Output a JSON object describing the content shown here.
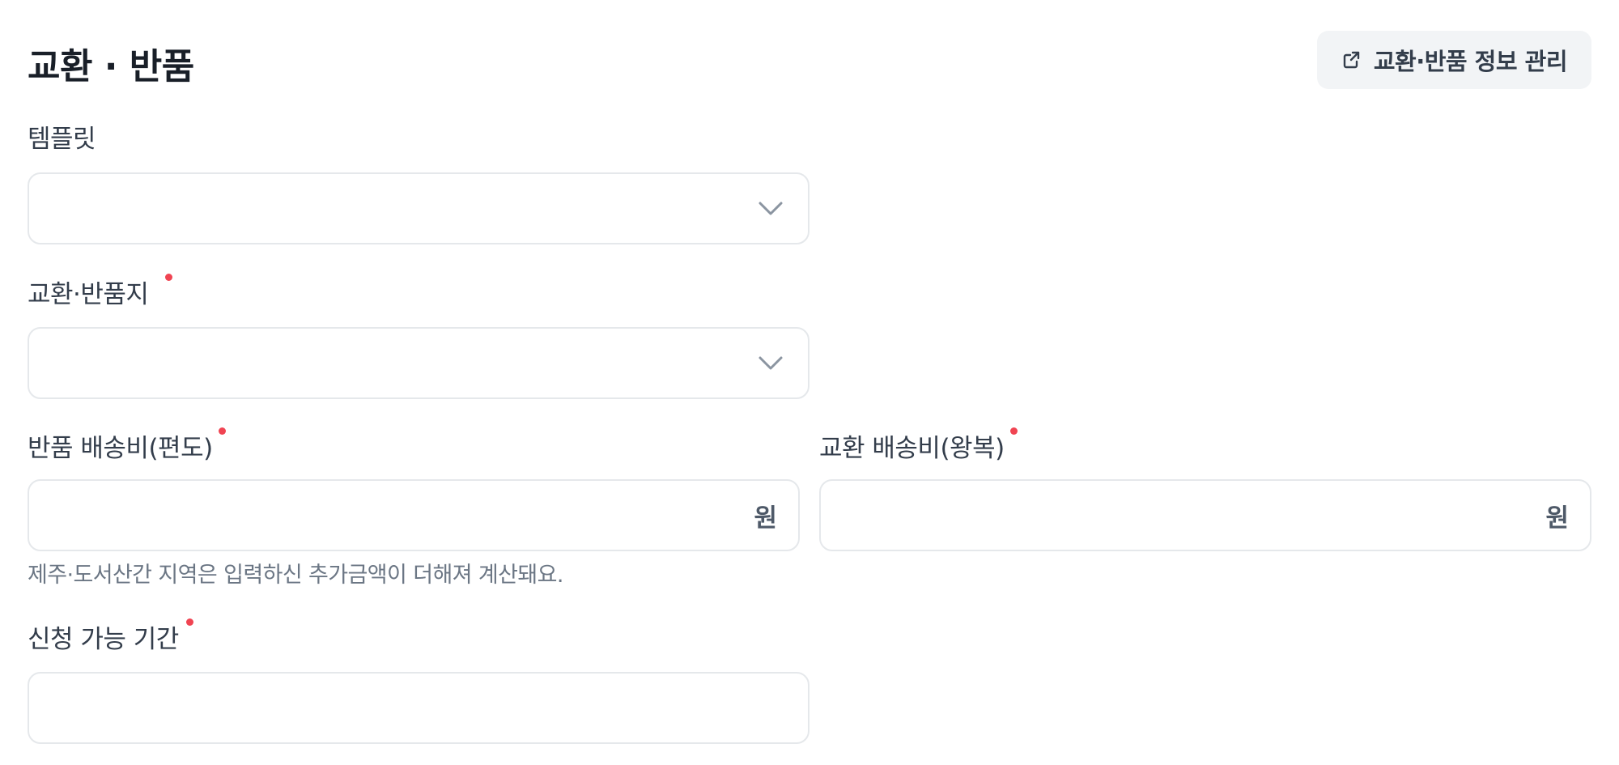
{
  "header": {
    "title": "교환 · 반품",
    "manage_button_label": "교환·반품 정보 관리"
  },
  "fields": {
    "template": {
      "label": "템플릿",
      "value": ""
    },
    "return_address": {
      "label": "교환·반품지",
      "value": ""
    },
    "return_fee": {
      "label": "반품 배송비(편도)",
      "value": "",
      "unit": "원"
    },
    "exchange_fee": {
      "label": "교환 배송비(왕복)",
      "value": "",
      "unit": "원"
    },
    "fee_helper": "제주·도서산간 지역은 입력하신 추가금액이 더해져 계산돼요.",
    "period": {
      "label": "신청 가능 기간",
      "value": ""
    }
  },
  "colors": {
    "required_dot": "#f04452",
    "border": "#e5e8eb",
    "button_bg": "#f2f4f6",
    "text_primary": "#191f28",
    "text_secondary": "#6b7684"
  },
  "icons": {
    "manage": "external-link-icon",
    "select": "chevron-down-icon"
  }
}
